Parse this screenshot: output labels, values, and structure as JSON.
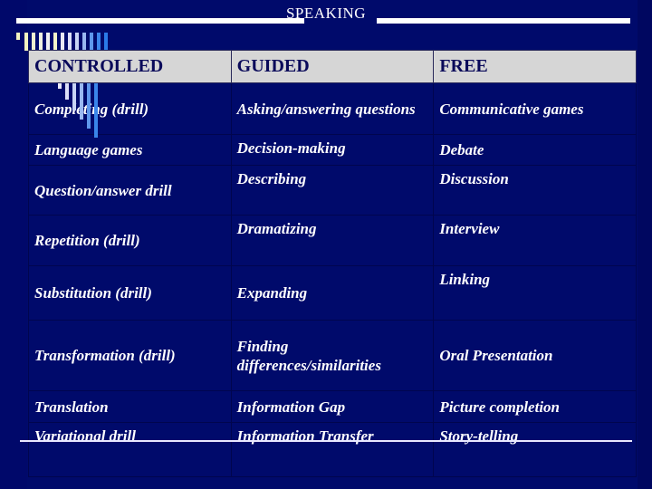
{
  "title": "SPEAKING",
  "table": {
    "headers": [
      "CONTROLLED",
      "GUIDED",
      "FREE"
    ],
    "rows": [
      [
        "Completing (drill)",
        "Asking/answering questions",
        "Communicative games"
      ],
      [
        "Language games",
        "Decision-making",
        "Debate"
      ],
      [
        "Question/answer drill",
        "Describing",
        "Discussion"
      ],
      [
        "Repetition (drill)",
        "Dramatizing",
        "Interview"
      ],
      [
        "Substitution (drill)",
        "Expanding",
        "Linking"
      ],
      [
        "Transformation (drill)",
        "Finding differences/similarities",
        "Oral Presentation"
      ],
      [
        "Translation",
        "Information Gap",
        "Picture completion"
      ],
      [
        "Variational drill",
        "Information Transfer",
        "Story-telling"
      ]
    ]
  },
  "colors": {
    "background": "#000a6b",
    "header_fill": "#d6d6d6",
    "header_text": "#0a0a5a",
    "body_text": "#ffffff"
  }
}
